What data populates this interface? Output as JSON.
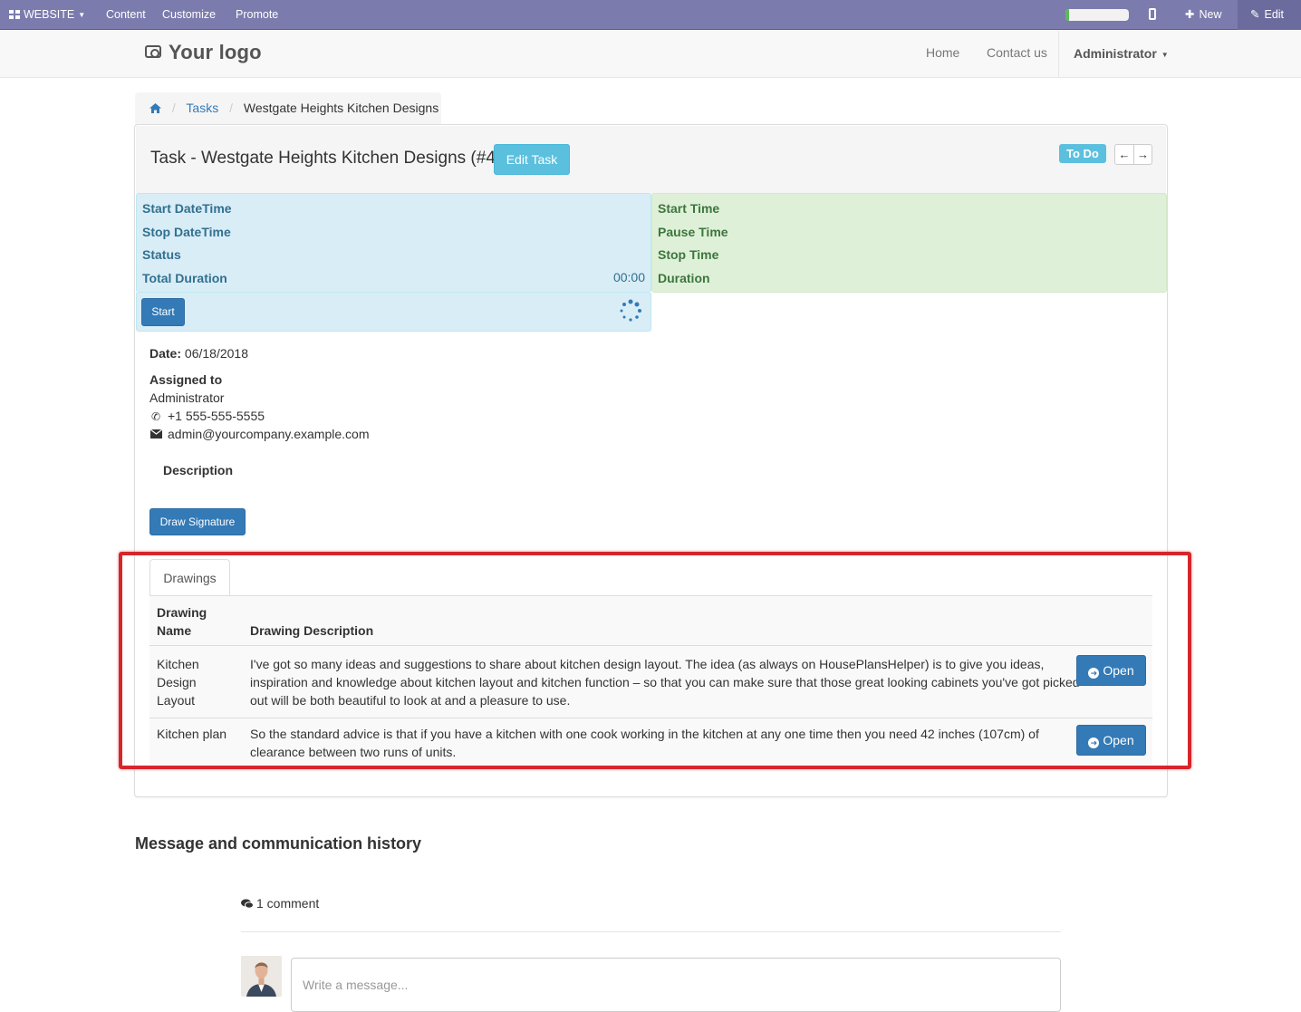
{
  "topbar": {
    "website": "WEBSITE",
    "content": "Content",
    "customize": "Customize",
    "promote": "Promote",
    "new": "New",
    "edit": "Edit",
    "progress": 0.05
  },
  "navbar": {
    "logo": "Your logo",
    "home": "Home",
    "contact": "Contact us",
    "user": "Administrator"
  },
  "breadcrumb": {
    "tasks": "Tasks",
    "current": "Westgate Heights Kitchen Designs"
  },
  "task": {
    "title": "Task - Westgate Heights Kitchen Designs (#41)",
    "edit_button": "Edit Task",
    "stage": "To Do"
  },
  "timer": {
    "left": {
      "start_datetime": "Start DateTime",
      "stop_datetime": "Stop DateTime",
      "status": "Status",
      "total_duration": "Total Duration",
      "total_duration_value": "00:00",
      "start_button": "Start"
    },
    "right": {
      "start_time": "Start Time",
      "pause_time": "Pause Time",
      "stop_time": "Stop Time",
      "duration": "Duration"
    }
  },
  "details": {
    "date_label": "Date:",
    "date_value": "06/18/2018",
    "assigned_label": "Assigned to",
    "assignee": "Administrator",
    "phone": "+1 555-555-5555",
    "email": "admin@yourcompany.example.com",
    "description_label": "Description",
    "draw_signature": "Draw Signature"
  },
  "drawings": {
    "tab": "Drawings",
    "col_name_line1": "Drawing",
    "col_name_line2": "Name",
    "col_description": "Drawing Description",
    "rows": [
      {
        "name_lines": [
          "Kitchen",
          "Design",
          "Layout"
        ],
        "desc_lines": [
          "I've got so many ideas and suggestions to share about kitchen design layout. The idea (as always on HousePlansHelper) is to give you ideas,",
          "inspiration and knowledge about kitchen layout and kitchen function – so that you can make sure that those great looking cabinets you've got picked",
          "out will be both beautiful to look at and a pleasure to use."
        ],
        "button": "Open"
      },
      {
        "name_lines": [
          "Kitchen plan"
        ],
        "desc_lines": [
          "So the standard advice is that if you have a kitchen with one cook working in the kitchen at any one time then you need 42 inches (107cm) of",
          "clearance between two runs of units."
        ],
        "button": "Open"
      }
    ]
  },
  "messages": {
    "title": "Message and communication history",
    "comment_count": "1 comment",
    "placeholder": "Write a message..."
  }
}
